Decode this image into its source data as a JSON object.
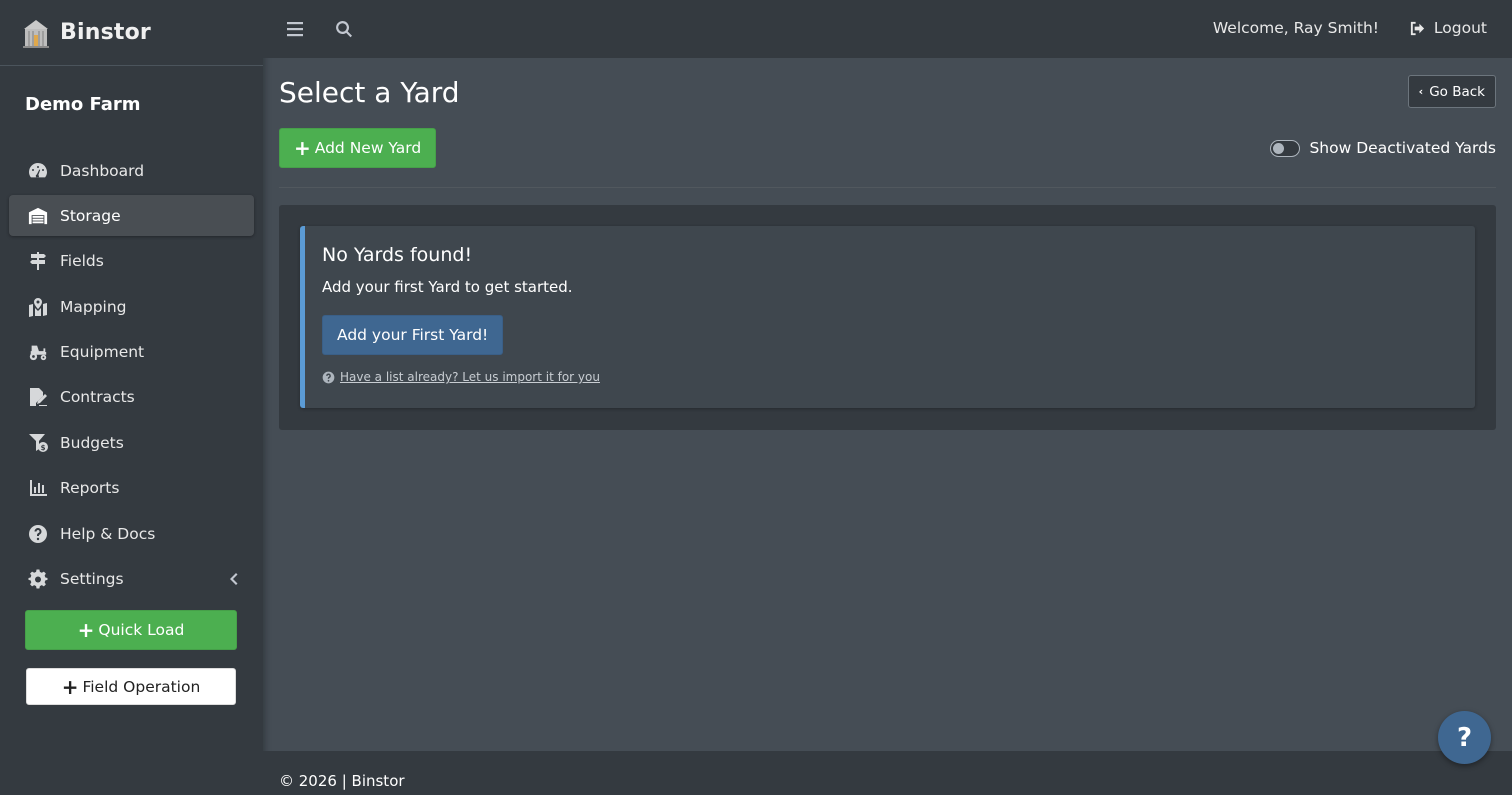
{
  "app": {
    "brand_name": "Binstor",
    "farm_name": "Demo Farm"
  },
  "sidebar": {
    "items": [
      {
        "label": "Dashboard",
        "icon": "dashboard-gauge-icon"
      },
      {
        "label": "Storage",
        "icon": "warehouse-icon",
        "active": true
      },
      {
        "label": "Fields",
        "icon": "signpost-icon"
      },
      {
        "label": "Mapping",
        "icon": "map-marked-icon"
      },
      {
        "label": "Equipment",
        "icon": "tractor-icon"
      },
      {
        "label": "Contracts",
        "icon": "file-signature-icon"
      },
      {
        "label": "Budgets",
        "icon": "funnel-dollar-icon"
      },
      {
        "label": "Reports",
        "icon": "bar-chart-icon"
      },
      {
        "label": "Help & Docs",
        "icon": "question-circle-icon"
      },
      {
        "label": "Settings",
        "icon": "gear-icon",
        "has_submenu": true
      }
    ],
    "quick_load_label": "Quick Load",
    "field_operation_label": "Field Operation"
  },
  "topbar": {
    "welcome_text": "Welcome, Ray Smith!",
    "logout_label": "Logout"
  },
  "main": {
    "page_title": "Select a Yard",
    "go_back_label": "Go Back",
    "add_new_yard_label": "Add New Yard",
    "show_deactivated_label": "Show Deactivated Yards",
    "show_deactivated_checked": false,
    "empty_state": {
      "title": "No Yards found!",
      "text": "Add your first Yard to get started.",
      "button_label": "Add your First Yard!",
      "import_link_text": "Have a list already? Let us import it for you"
    }
  },
  "footer": {
    "text": "© 2026 | Binstor"
  },
  "help_fab": {
    "label": "?"
  },
  "colors": {
    "sidebar_bg": "#343a40",
    "content_bg": "#454d55",
    "success_green": "#4caf50",
    "primary_blue": "#3f6791",
    "callout_accent": "#5b9bd5"
  }
}
